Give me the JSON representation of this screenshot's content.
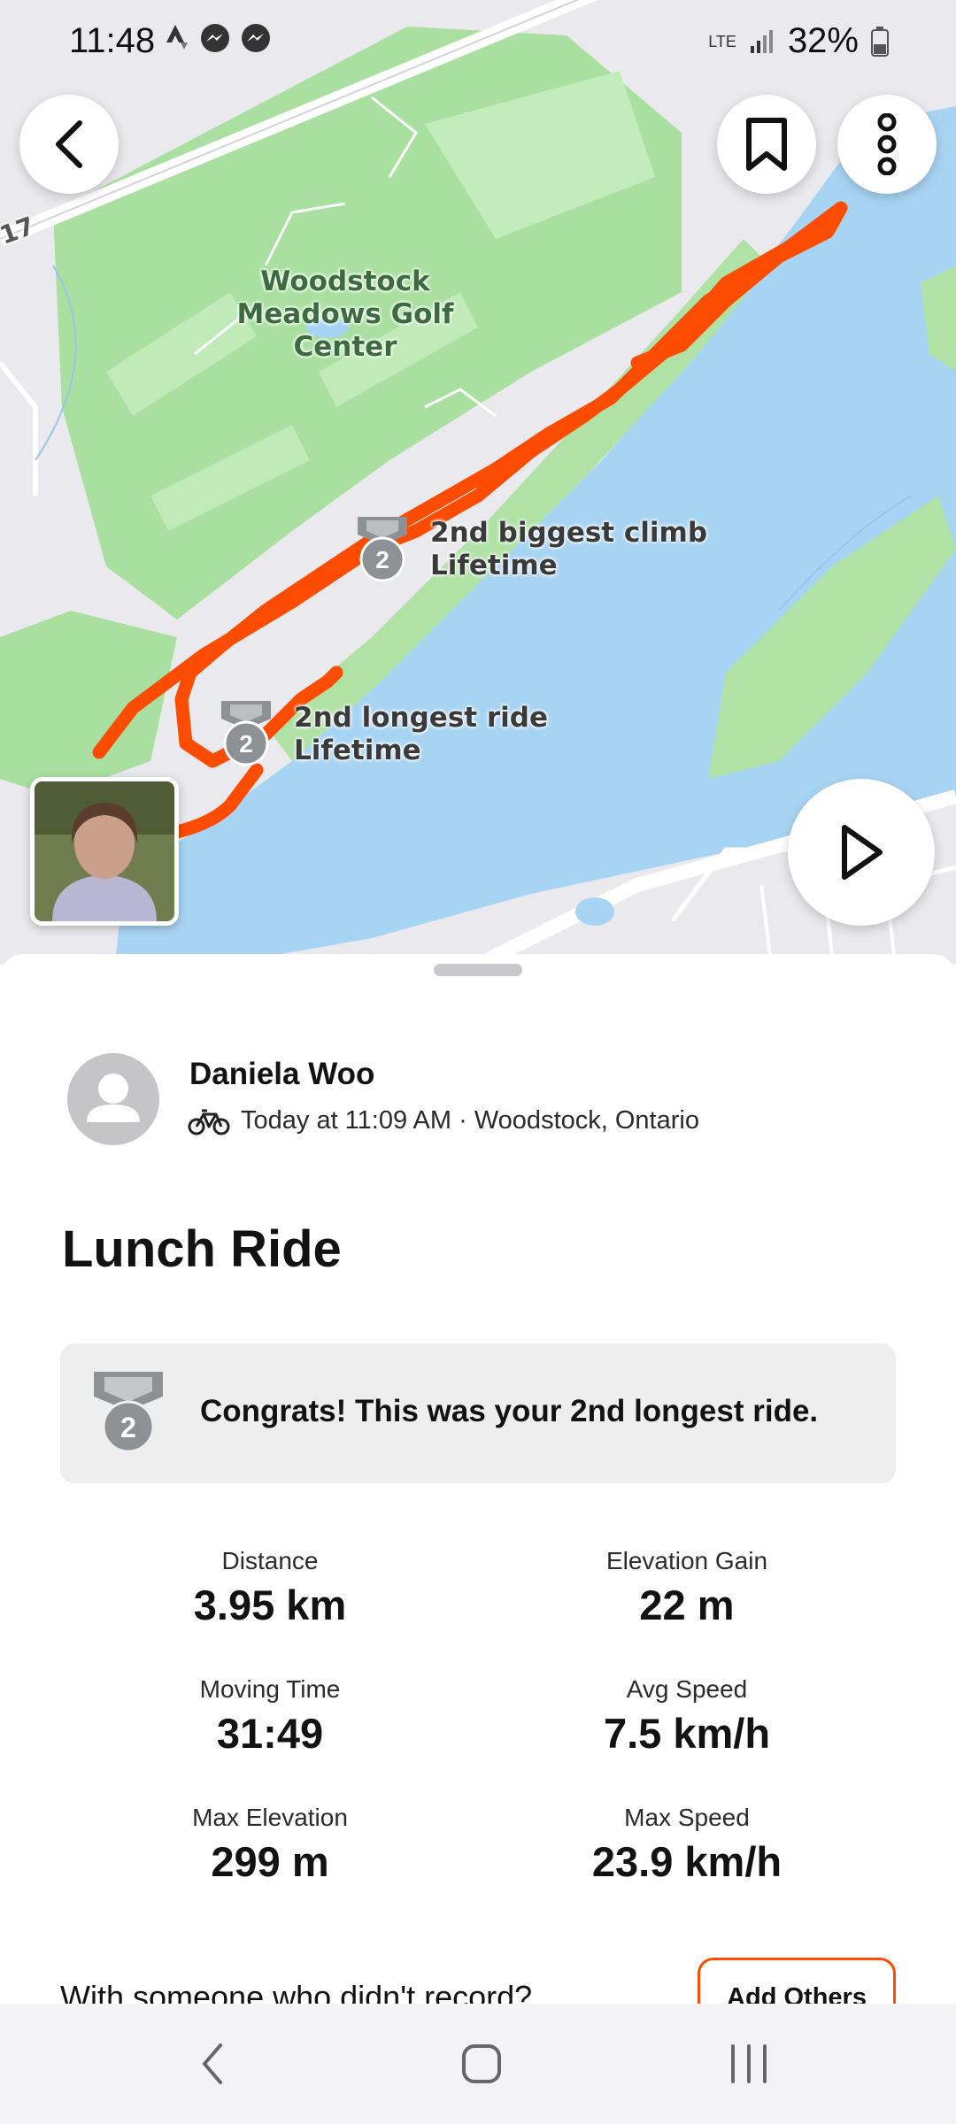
{
  "status_bar": {
    "time": "11:48",
    "battery": "32%",
    "network": "LTE",
    "icons": [
      "strava-icon",
      "messenger-icon",
      "messenger-icon",
      "signal-icon",
      "battery-icon"
    ]
  },
  "map": {
    "place_label": "Woodstock Meadows Golf Center",
    "road_number": "17",
    "achievements": [
      {
        "rank": "2",
        "line1": "2nd biggest climb",
        "line2": "Lifetime"
      },
      {
        "rank": "2",
        "line1": "2nd longest ride",
        "line2": "Lifetime"
      }
    ],
    "route_color": "#fc4c02",
    "water_color": "#a7d3f2",
    "park_color": "#a9dfa0"
  },
  "activity": {
    "athlete_name": "Daniela Woo",
    "meta": "Today at 11:09 AM · Woodstock, Ontario",
    "title": "Lunch Ride",
    "congrats": {
      "rank": "2",
      "text": "Congrats! This was your 2nd longest ride."
    },
    "stats": {
      "distance": {
        "label": "Distance",
        "value": "3.95 km"
      },
      "elevation_gain": {
        "label": "Elevation Gain",
        "value": "22 m"
      },
      "moving_time": {
        "label": "Moving Time",
        "value": "31:49"
      },
      "avg_speed": {
        "label": "Avg Speed",
        "value": "7.5 km/h"
      },
      "max_elevation": {
        "label": "Max Elevation",
        "value": "299 m"
      },
      "max_speed": {
        "label": "Max Speed",
        "value": "23.9 km/h"
      }
    },
    "with_someone": "With someone who didn't record?",
    "add_others_label": "Add Others"
  },
  "accent": "#fc4c02"
}
